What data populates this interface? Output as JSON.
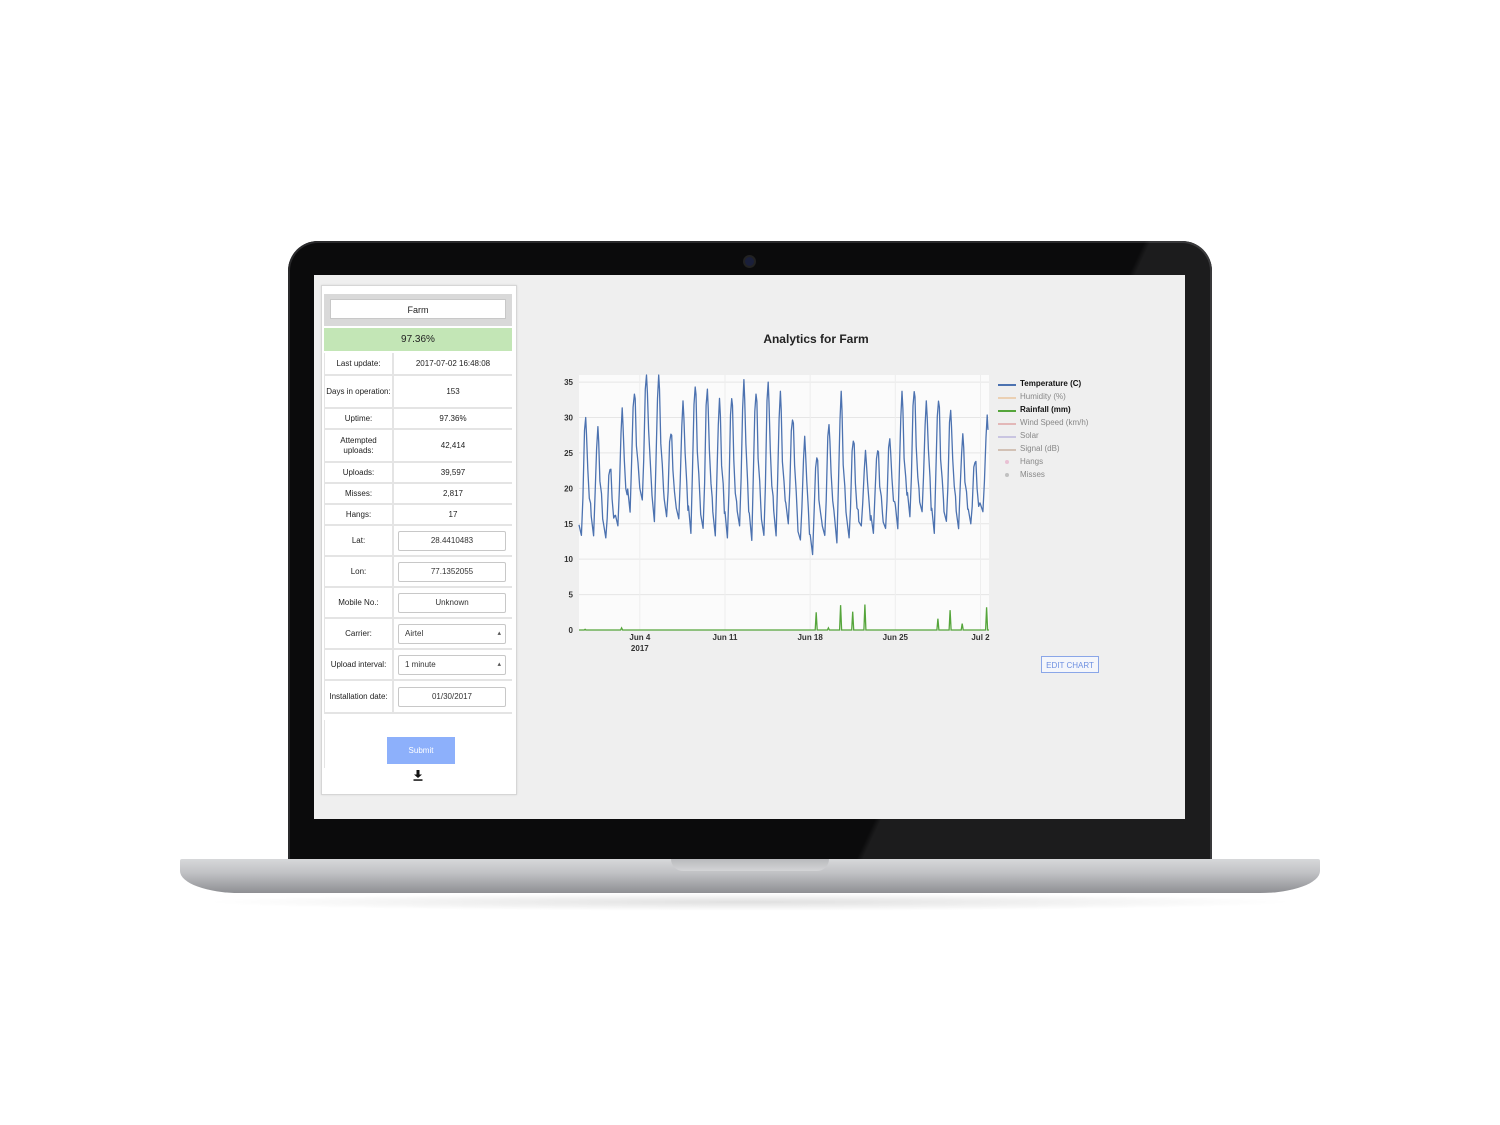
{
  "panel": {
    "name": "Farm",
    "uptime_banner": "97.36%",
    "rows": [
      {
        "label": "Last update:",
        "value": "2017-07-02 16:48:08"
      },
      {
        "label": "Days in operation:",
        "value": "153"
      },
      {
        "label": "Uptime:",
        "value": "97.36%"
      },
      {
        "label": "Attempted uploads:",
        "value": "42,414"
      },
      {
        "label": "Uploads:",
        "value": "39,597"
      },
      {
        "label": "Misses:",
        "value": "2,817"
      },
      {
        "label": "Hangs:",
        "value": "17"
      }
    ],
    "lat_label": "Lat:",
    "lat_value": "28.4410483",
    "lon_label": "Lon:",
    "lon_value": "77.1352055",
    "mobile_label": "Mobile No.:",
    "mobile_value": "Unknown",
    "carrier_label": "Carrier:",
    "carrier_value": "Airtel",
    "interval_label": "Upload interval:",
    "interval_value": "1 minute",
    "install_label": "Installation date:",
    "install_value": "01/30/2017",
    "submit_label": "Submit",
    "download_icon": "download-icon"
  },
  "chart_title": "Analytics for Farm",
  "edit_chart_label": "EDIT CHART",
  "chart_data": {
    "type": "line",
    "title": "Analytics for Farm",
    "xlabel": "",
    "ylabel": "",
    "ylim": [
      0,
      36
    ],
    "xlim": [
      "2017-05-30",
      "2017-07-02"
    ],
    "x_ticks": [
      "Jun 4\n2017",
      "Jun 11",
      "Jun 18",
      "Jun 25",
      "Jul 2"
    ],
    "y_ticks": [
      0,
      5,
      10,
      15,
      20,
      25,
      30,
      35
    ],
    "grid": true,
    "legend_position": "right",
    "legend": [
      {
        "name": "Temperature (C)",
        "color": "#4c72b0",
        "visible": true,
        "kind": "line"
      },
      {
        "name": "Humidity (%)",
        "color": "#e8b682",
        "visible": false,
        "kind": "line"
      },
      {
        "name": "Rainfall (mm)",
        "color": "#55a53b",
        "visible": true,
        "kind": "line"
      },
      {
        "name": "Wind Speed (km/h)",
        "color": "#d88a8a",
        "visible": false,
        "kind": "line"
      },
      {
        "name": "Solar",
        "color": "#a9a3d6",
        "visible": false,
        "kind": "line"
      },
      {
        "name": "Signal (dB)",
        "color": "#b99a85",
        "visible": false,
        "kind": "line"
      },
      {
        "name": "Hangs",
        "color": "#e39bbd",
        "visible": false,
        "kind": "marker"
      },
      {
        "name": "Misses",
        "color": "#9a9a9a",
        "visible": false,
        "kind": "marker"
      }
    ],
    "series": [
      {
        "name": "Temperature (C)",
        "x": [
          "2017-05-30",
          "2017-05-31",
          "2017-06-01",
          "2017-06-02",
          "2017-06-03",
          "2017-06-04",
          "2017-06-05",
          "2017-06-06",
          "2017-06-07",
          "2017-06-08",
          "2017-06-09",
          "2017-06-10",
          "2017-06-11",
          "2017-06-12",
          "2017-06-13",
          "2017-06-14",
          "2017-06-15",
          "2017-06-16",
          "2017-06-17",
          "2017-06-18",
          "2017-06-19",
          "2017-06-20",
          "2017-06-21",
          "2017-06-22",
          "2017-06-23",
          "2017-06-24",
          "2017-06-25",
          "2017-06-26",
          "2017-06-27",
          "2017-06-28",
          "2017-06-29",
          "2017-06-30",
          "2017-07-01",
          "2017-07-02"
        ],
        "min": [
          13,
          14,
          13,
          14,
          17,
          18,
          16,
          16,
          15,
          14,
          14,
          14,
          13,
          14,
          13,
          13,
          14,
          15,
          12,
          11,
          13,
          13,
          13,
          14,
          14,
          14,
          15,
          16,
          16,
          14,
          15,
          15,
          15,
          16
        ],
        "max": [
          30,
          28,
          23,
          31,
          34,
          36,
          36,
          28,
          32,
          35,
          34,
          32,
          33,
          35,
          34,
          35,
          33,
          30,
          27,
          25,
          29,
          33,
          27,
          25,
          26,
          27,
          33,
          34,
          32,
          33,
          31,
          27,
          24,
          30
        ]
      },
      {
        "name": "Rainfall (mm)",
        "x": [
          "2017-05-30",
          "2017-06-02",
          "2017-06-18",
          "2017-06-19",
          "2017-06-20",
          "2017-06-21",
          "2017-06-22",
          "2017-06-28",
          "2017-06-29",
          "2017-06-30",
          "2017-07-02"
        ],
        "values": [
          0.1,
          0.3,
          2.5,
          0.3,
          3.5,
          2.6,
          3.6,
          1.6,
          2.8,
          0.9,
          3.2
        ]
      }
    ]
  }
}
